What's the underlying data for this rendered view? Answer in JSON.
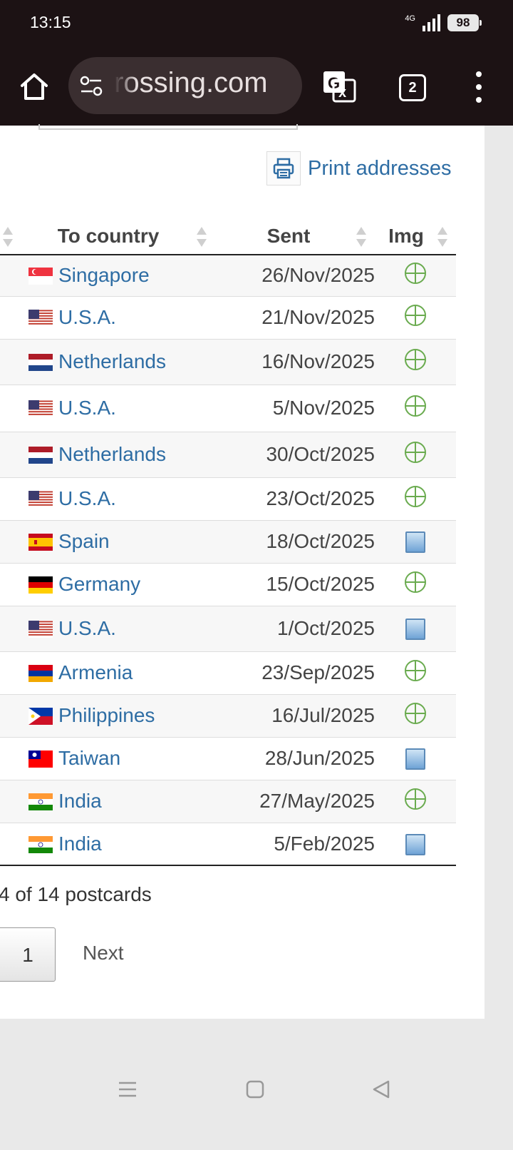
{
  "status_bar": {
    "time": "13:15",
    "network": "4G",
    "battery": "98"
  },
  "browser": {
    "url": "rossing.com",
    "tab_count": "2"
  },
  "print_link": {
    "label": "Print addresses"
  },
  "table": {
    "headers": {
      "country": "To country",
      "sent": "Sent",
      "img": "Img"
    },
    "rows": [
      {
        "country": "Singapore",
        "flag": "singapore",
        "sent": "26/Nov/2025",
        "img": "plus-icon"
      },
      {
        "country": "U.S.A.",
        "flag": "usa",
        "sent": "21/Nov/2025",
        "img": "plus-icon"
      },
      {
        "country": "Netherlands",
        "flag": "netherlands",
        "sent": "16/Nov/2025",
        "img": "plus-icon"
      },
      {
        "country": "U.S.A.",
        "flag": "usa",
        "sent": "5/Nov/2025",
        "img": "plus-icon"
      },
      {
        "country": "Netherlands",
        "flag": "netherlands",
        "sent": "30/Oct/2025",
        "img": "plus-icon"
      },
      {
        "country": "U.S.A.",
        "flag": "usa",
        "sent": "23/Oct/2025",
        "img": "plus-icon"
      },
      {
        "country": "Spain",
        "flag": "spain",
        "sent": "18/Oct/2025",
        "img": "photo-icon"
      },
      {
        "country": "Germany",
        "flag": "germany",
        "sent": "15/Oct/2025",
        "img": "plus-icon"
      },
      {
        "country": "U.S.A.",
        "flag": "usa",
        "sent": "1/Oct/2025",
        "img": "photo-icon"
      },
      {
        "country": "Armenia",
        "flag": "armenia",
        "sent": "23/Sep/2025",
        "img": "plus-icon"
      },
      {
        "country": "Philippines",
        "flag": "philippines",
        "sent": "16/Jul/2025",
        "img": "plus-icon"
      },
      {
        "country": "Taiwan",
        "flag": "taiwan",
        "sent": "28/Jun/2025",
        "img": "photo-icon"
      },
      {
        "country": "India",
        "flag": "india",
        "sent": "27/May/2025",
        "img": "plus-icon"
      },
      {
        "country": "India",
        "flag": "india",
        "sent": "5/Feb/2025",
        "img": "photo-icon"
      }
    ]
  },
  "footer": {
    "count_text": "4 of 14 postcards",
    "page_number": "1",
    "next_label": "Next"
  },
  "colors": {
    "link": "#2e6da4",
    "toolbar_bg": "#1c1214",
    "plus_icon": "#6aab4f"
  }
}
